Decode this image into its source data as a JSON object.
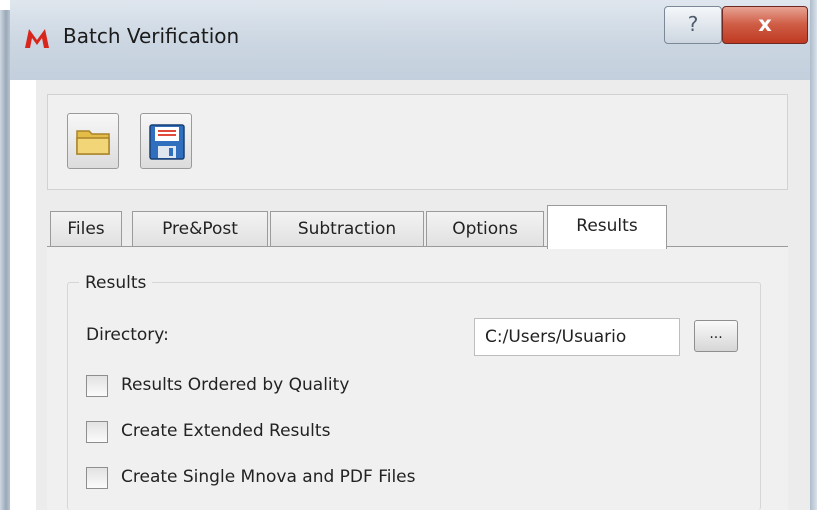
{
  "window": {
    "title": "Batch Verification",
    "help_label": "?",
    "close_label": "x"
  },
  "toolbar": {
    "open_icon": "folder-icon",
    "save_icon": "floppy-disk-icon"
  },
  "tabs": [
    {
      "label": "Files",
      "active": false
    },
    {
      "label": "Pre&Post",
      "active": false
    },
    {
      "label": "Subtraction",
      "active": false
    },
    {
      "label": "Options",
      "active": false
    },
    {
      "label": "Results",
      "active": true
    }
  ],
  "results": {
    "group_title": "Results",
    "directory_label": "Directory:",
    "directory_value": "C:/Users/Usuario",
    "browse_label": "...",
    "options": [
      {
        "label": "Results Ordered by Quality",
        "checked": false
      },
      {
        "label": "Create Extended Results",
        "checked": false
      },
      {
        "label": "Create Single Mnova and PDF Files",
        "checked": false
      }
    ]
  },
  "colors": {
    "close_button": "#c8472f",
    "titlebar": "#cbd6e2",
    "folder": "#e8c85a",
    "save": "#3a78c4"
  }
}
